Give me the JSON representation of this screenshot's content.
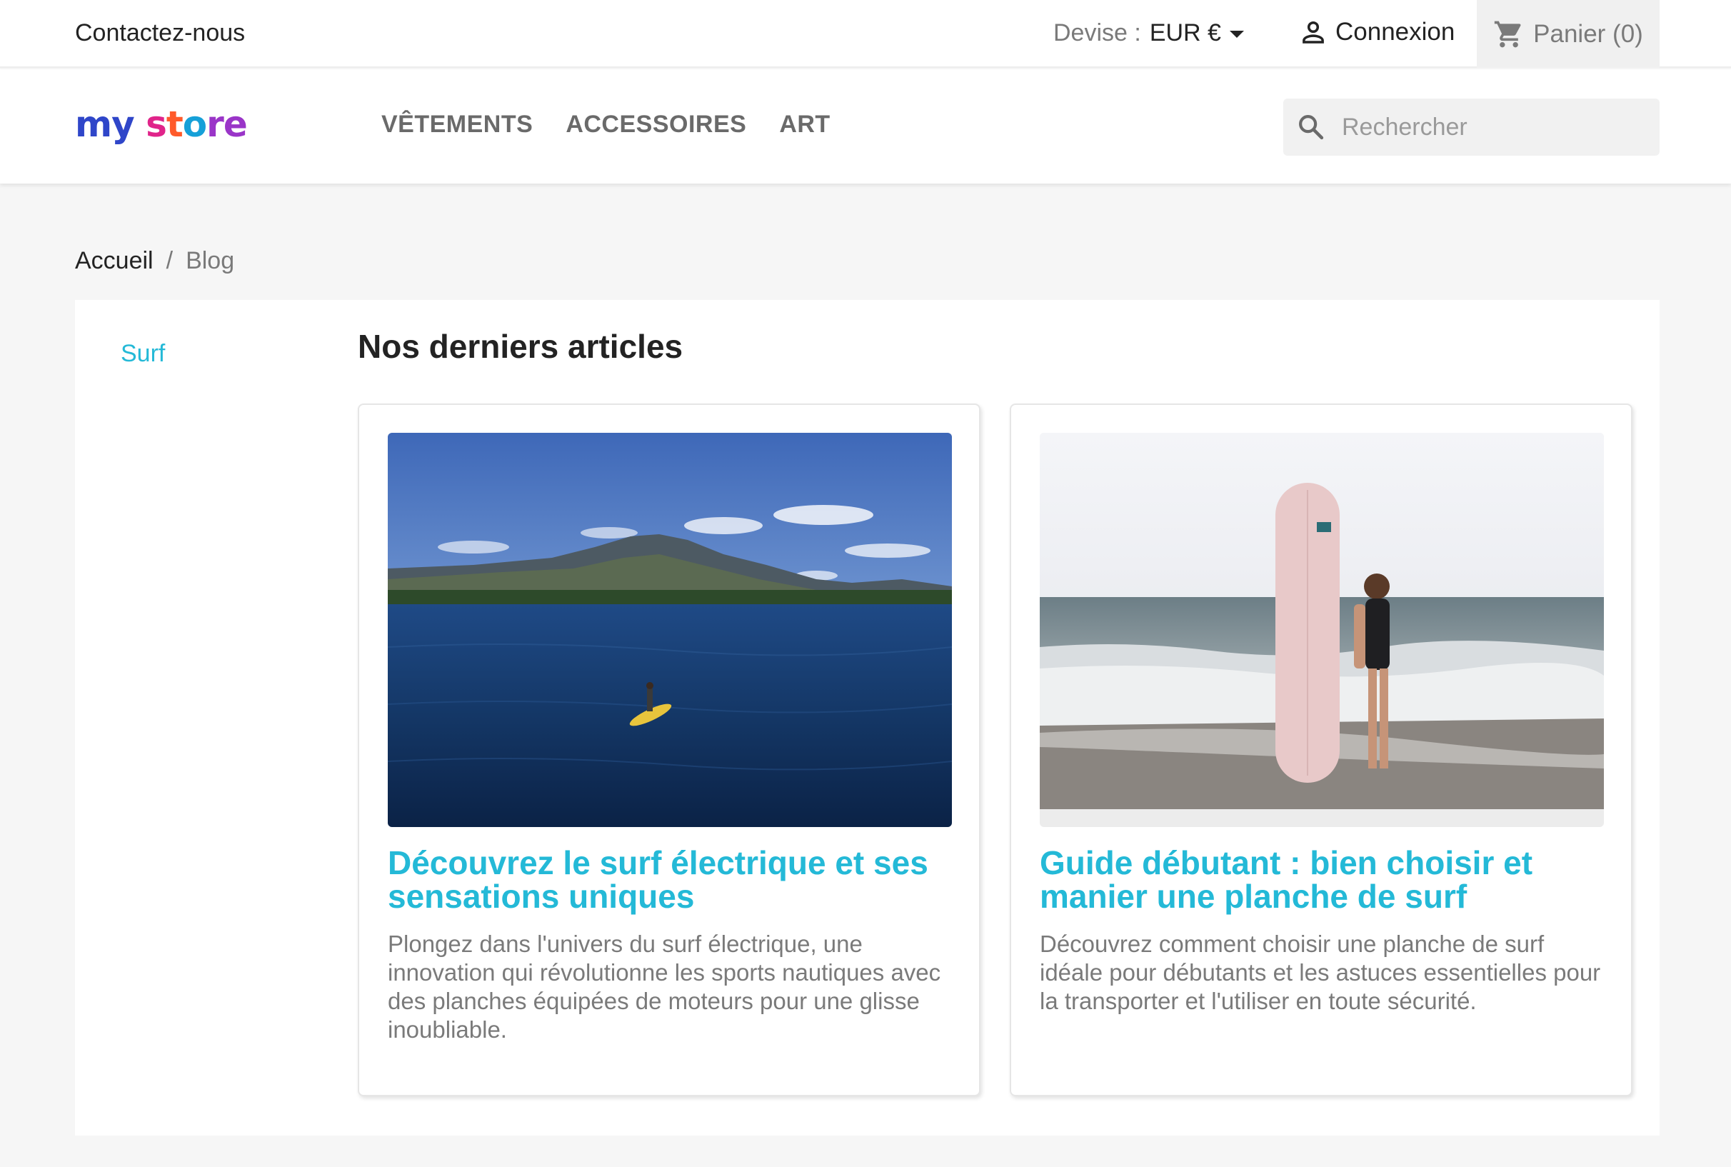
{
  "topbar": {
    "contact": "Contactez-nous",
    "currency_label": "Devise :",
    "currency_value": "EUR €",
    "login": "Connexion",
    "cart": "Panier (0)"
  },
  "header": {
    "logo": {
      "part1": "my",
      "part2": "s",
      "part3": "t",
      "part4": "o",
      "part5": "re"
    },
    "nav": [
      "VÊTEMENTS",
      "ACCESSOIRES",
      "ART"
    ],
    "search_placeholder": "Rechercher"
  },
  "breadcrumb": {
    "home": "Accueil",
    "separator": "/",
    "current": "Blog"
  },
  "sidebar": {
    "categories": [
      "Surf"
    ]
  },
  "main": {
    "title": "Nos derniers articles",
    "articles": [
      {
        "title": "Découvrez le surf électrique et ses sensations uniques",
        "excerpt": "Plongez dans l'univers du surf électrique, une innovation qui révolutionne les sports nautiques avec des planches équipées de moteurs pour une glisse inoubliable."
      },
      {
        "title": "Guide débutant : bien choisir et manier une planche de surf",
        "excerpt": "Découvrez comment choisir une planche de surf idéale pour débutants et les astuces essentielles pour la transporter et l'utiliser en toute sécurité."
      }
    ]
  },
  "colors": {
    "accent": "#24b9d7",
    "text": "#232323",
    "muted": "#7a7a7a",
    "background": "#f6f6f6"
  },
  "icons": {
    "login": "user-icon",
    "cart": "shopping-cart-icon",
    "search": "search-icon",
    "currency": "caret-down-icon"
  }
}
